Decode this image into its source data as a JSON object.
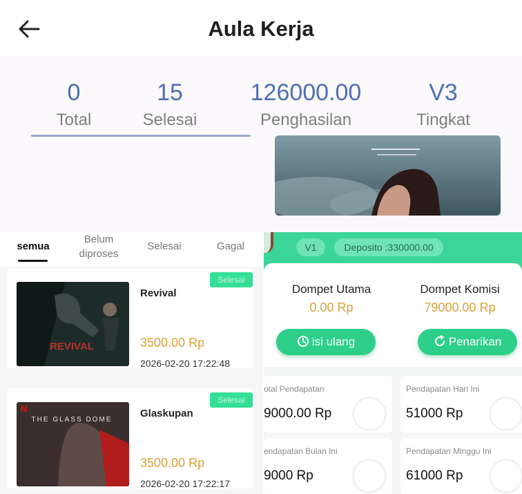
{
  "header": {
    "title": "Aula Kerja"
  },
  "stats": [
    {
      "value": "0",
      "label": "Total"
    },
    {
      "value": "15",
      "label": "Selesai"
    },
    {
      "value": "126000.00",
      "label": "Penghasilan"
    },
    {
      "value": "V3",
      "label": "Tingkat"
    }
  ],
  "tabs": [
    {
      "label": "semua"
    },
    {
      "label": "Belum\ndiproses"
    },
    {
      "label": "Selesai"
    },
    {
      "label": "Gagal"
    }
  ],
  "active_tab": "semua",
  "tasks": [
    {
      "title": "Revival",
      "price": "3500.00 Rp",
      "time": "2026-02-20 17:22:48",
      "status": "Selesai",
      "poster_text": "REVIVAL"
    },
    {
      "title": "Glaskupan",
      "price": "3500.00 Rp",
      "time": "2026-02-20 17:22:17",
      "status": "Selesai",
      "poster_text": "THE GLASS DOME"
    }
  ],
  "wallet": {
    "level": "V1",
    "deposit": "Deposito :330000.00",
    "main_label": "Dompet Utama",
    "main_value": "0.00 Rp",
    "commission_label": "Dompet Komisi",
    "commission_value": "79000.00 Rp",
    "topup_label": "isi ulang",
    "withdraw_label": "Penarikan"
  },
  "earnings": [
    {
      "label": "otal Pendapatan",
      "value": "9000.00 Rp"
    },
    {
      "label": "Pendapatan Hari Ini",
      "value": "51000 Rp"
    },
    {
      "label": "endapatan Bulan Ini",
      "value": "9000 Rp"
    },
    {
      "label": "Pendapatan Minggu Ini",
      "value": "61000 Rp"
    }
  ],
  "colors": {
    "accent_green": "#2ecf8b",
    "stat_blue": "#4d6fb3",
    "price_gold": "#d9a23a"
  }
}
